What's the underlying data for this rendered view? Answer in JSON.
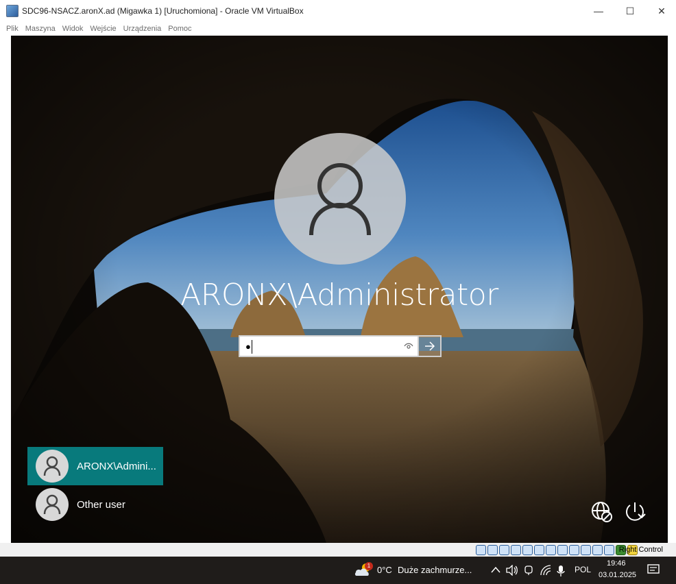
{
  "window": {
    "title": "SDC96-NSACZ.aronX.ad (Migawka 1) [Uruchomiona] - Oracle VM VirtualBox",
    "minimize": "—",
    "maximize": "☐",
    "close": "✕"
  },
  "menu": [
    "Plik",
    "Maszyna",
    "Widok",
    "Wejście",
    "Urządzenia",
    "Pomoc"
  ],
  "login": {
    "username": "ARONX\\Administrator",
    "password_mask": "●",
    "reveal_icon": "eye-icon",
    "submit_icon": "arrow-right-icon"
  },
  "user_tiles": [
    {
      "label": "ARONX\\Admini...",
      "selected": true
    },
    {
      "label": "Other user",
      "selected": false
    }
  ],
  "corner_icons": [
    "accessibility-network-icon",
    "power-icon"
  ],
  "vbox_status": {
    "host_key": "Right Control"
  },
  "taskbar": {
    "weather_badge": "1",
    "weather_temp": "0°C",
    "weather_desc": "Duże zachmurze...",
    "language": "POL",
    "time": "19:46",
    "date": "03.01.2025"
  },
  "colors": {
    "selected_tile": "#087a7c",
    "taskbar": "#1f1c1a"
  }
}
